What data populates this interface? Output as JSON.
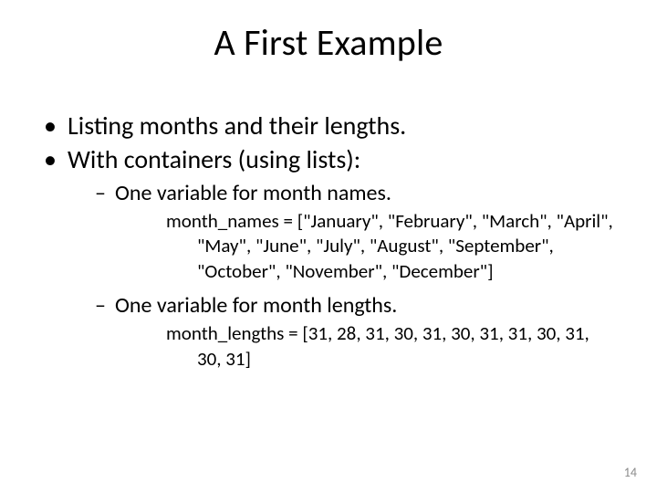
{
  "title": "A First Example",
  "bullets": {
    "b1": "Listing months and their lengths.",
    "b2": "With containers (using lists):",
    "s1": "One variable for month names.",
    "code1": "month_names = [\"January\", \"February\", \"March\", \"April\", \"May\", \"June\", \"July\", \"August\", \"September\", \"October\", \"November\", \"December\"]",
    "s2": "One variable for month lengths.",
    "code2": "month_lengths = [31, 28, 31, 30, 31, 30, 31, 31, 30, 31, 30, 31]"
  },
  "page_number": "14"
}
